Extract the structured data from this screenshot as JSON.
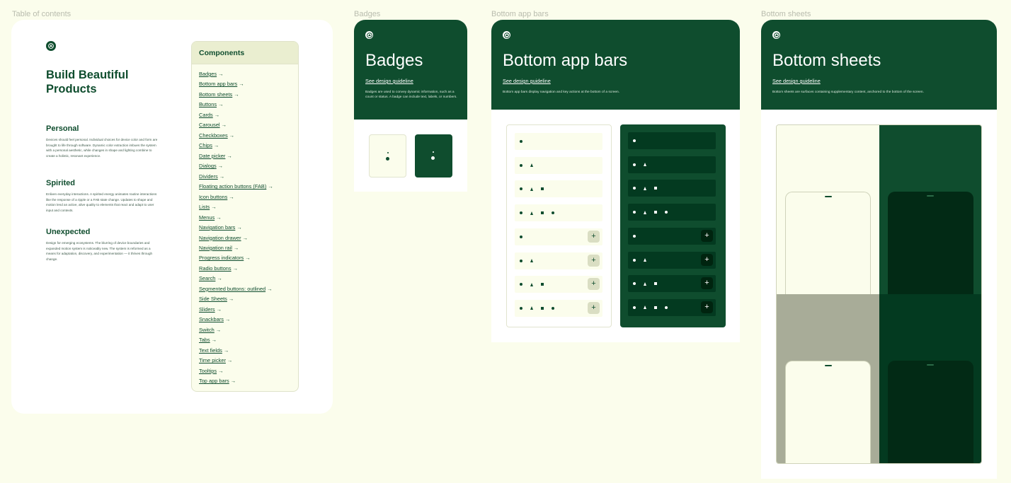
{
  "frames": {
    "toc_label": "Table of contents",
    "badges_label": "Badges",
    "bab_label": "Bottom app bars",
    "sheets_label": "Bottom sheets"
  },
  "toc": {
    "logo_icon": "brand-logo-icon",
    "hero_title": "Build Beautiful Products",
    "sections": [
      {
        "title": "Personal",
        "body": "Devices should feel personal. Individual choices for device color and form are brought to life through software. Dynamic color extraction imbues the system with a personal aesthetic, while changes in shape and lighting combine to create a holistic, resonant experience."
      },
      {
        "title": "Spirited",
        "body": "Enliven everyday interactions. A spirited energy animates routine interactions like the response of a ripple or a FAB state change. Updates to shape and motion lend an active, alive quality to elements that react and adapt to user input and contexts."
      },
      {
        "title": "Unexpected",
        "body": "Design for emerging ecosystems. The blurring of device boundaries and expanded motion system is noticeably new. The system is reformed as a means for adaptation, discovery, and experimentation — it thrives through change."
      }
    ],
    "components_title": "Components",
    "arrow": "→",
    "components": [
      "Badges",
      "Bottom app bars",
      "Bottom sheets",
      "Buttons",
      "Cards",
      "Carousel",
      "Checkboxes",
      "Chips",
      "Date picker",
      "Dialogs",
      "Dividers",
      "Floating action buttons (FAB)",
      "Icon buttons",
      "Lists",
      "Menus",
      "Navigation bars",
      "Navigation drawer",
      "Navigation rail",
      "Progress indicators",
      "Radio buttons",
      "Search",
      "Segmented buttons: outlined",
      "Side Sheets",
      "Sliders",
      "Snackbars",
      "Switch",
      "Tabs",
      "Text fields",
      "Time picker",
      "Tooltips",
      "Top app bars"
    ]
  },
  "badges": {
    "title": "Badges",
    "guideline": "See design guideline",
    "description": "Badges are used to convey dynamic information, such as a count or status. A badge can include text, labels, or numbers."
  },
  "bab": {
    "title": "Bottom app bars",
    "guideline": "See design guideline",
    "description": "Bottom app bars display navigation and key actions at the bottom of a screen.",
    "fab_symbol": "+"
  },
  "sheets": {
    "title": "Bottom sheets",
    "guideline": "See design guideline",
    "description": "Bottom sheets are surfaces containing supplementary content, anchored to the bottom of the screen."
  },
  "colors": {
    "primary": "#0f4d2e",
    "background": "#fbfdec",
    "surface": "#ffffff",
    "neutral": "#a8ac98"
  }
}
